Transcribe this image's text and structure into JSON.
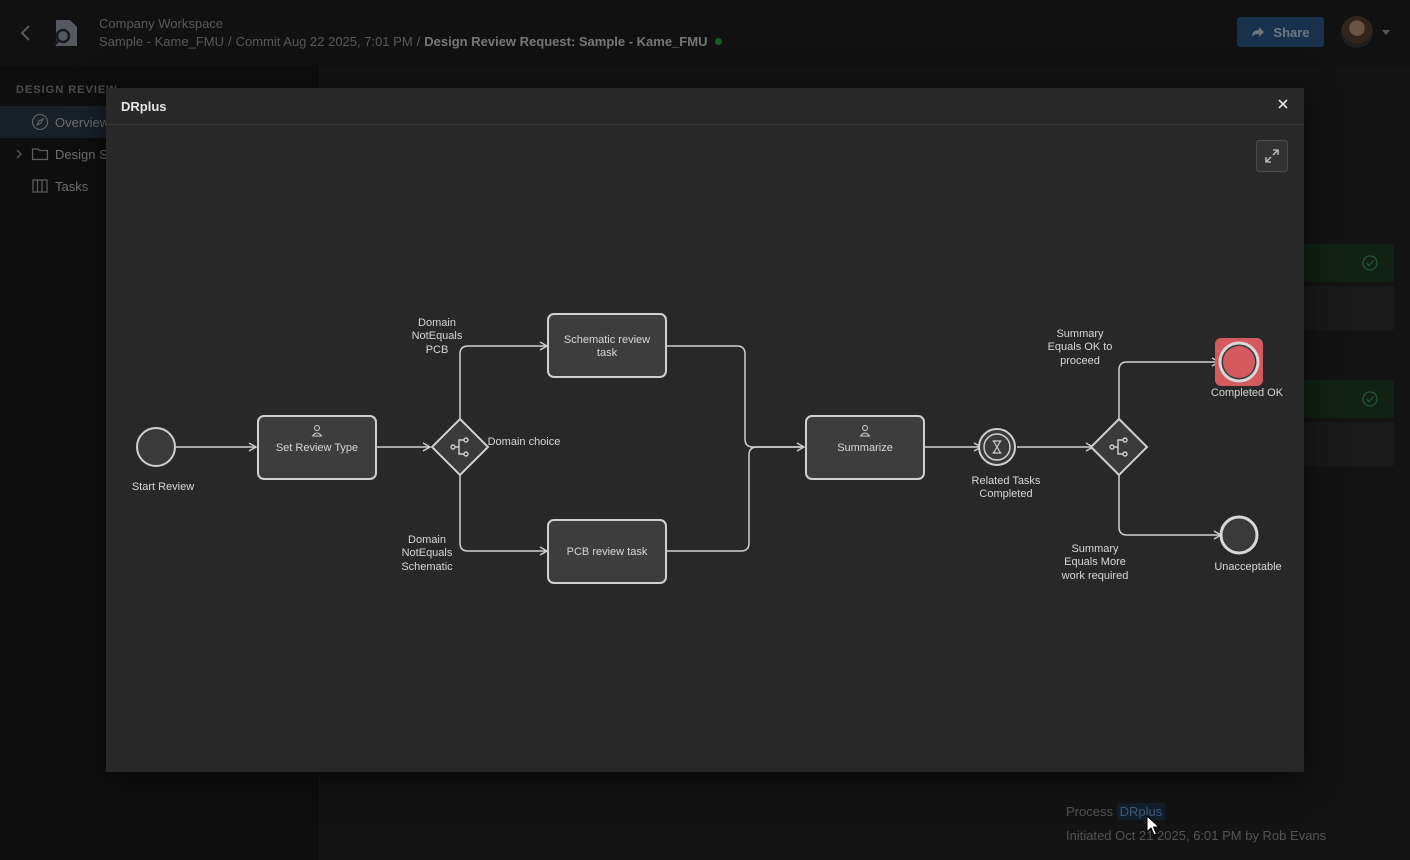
{
  "header": {
    "workspace": "Company Workspace",
    "breadcrumb": {
      "project": "Sample - Kame_FMU",
      "commit": "Commit Aug 22 2025, 7:01 PM",
      "current": "Design Review Request: Sample - Kame_FMU",
      "separator": "/"
    },
    "share_label": "Share",
    "status_color": "#27a844"
  },
  "sidebar": {
    "section_header": "DESIGN REVIEW",
    "items": [
      {
        "label": "Overview",
        "icon": "compass-icon",
        "active": true
      },
      {
        "label": "Design Snapshots",
        "icon": "folder-icon",
        "expandable": true
      },
      {
        "label": "Tasks",
        "icon": "board-icon"
      }
    ]
  },
  "process": {
    "label": "Process",
    "link": "DRplus",
    "initiated": "Initiated Oct 21 2025, 6:01 PM by Rob Evans"
  },
  "modal": {
    "title": "DRplus",
    "close_icon": "close-icon",
    "expand_icon": "expand-icon"
  },
  "diagram": {
    "nodes": {
      "start": "Start Review",
      "set_review_type": "Set Review Type",
      "domain_gateway": "Domain choice",
      "schematic_task": [
        "Schematic review",
        "task"
      ],
      "pcb_task": "PCB review task",
      "summarize": "Summarize",
      "timer": [
        "Related Tasks",
        "Completed"
      ],
      "end_ok": "Completed OK",
      "end_bad": "Unacceptable"
    },
    "conditions": {
      "not_pcb": [
        "Domain",
        "NotEquals",
        "PCB"
      ],
      "not_schematic": [
        "Domain",
        "NotEquals",
        "Schematic"
      ],
      "ok_to_proceed": [
        "Summary",
        "Equals OK to",
        "proceed"
      ],
      "more_work": [
        "Summary",
        "Equals More",
        "work required"
      ]
    },
    "colors": {
      "active_end": "#d45a5e",
      "line": "#d0d0d0",
      "task_fill": "#3d3d3d"
    }
  }
}
